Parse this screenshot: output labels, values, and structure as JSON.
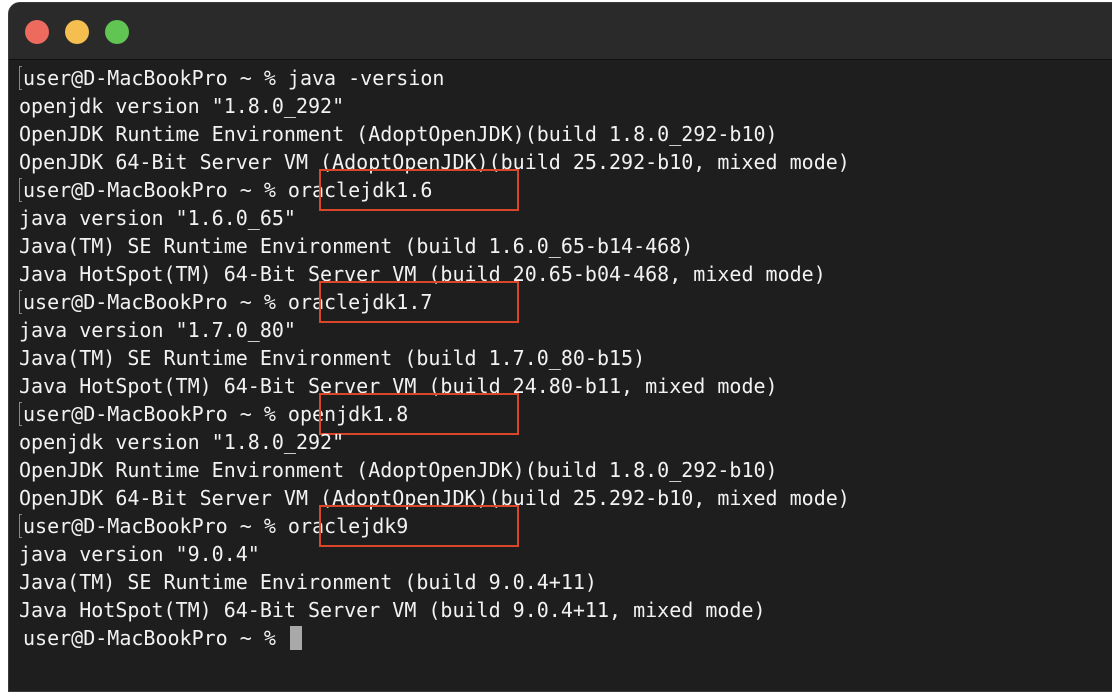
{
  "window": {
    "traffic_light_colors": {
      "close": "#ed6a5e",
      "minimize": "#f5bf4f",
      "zoom": "#61c554"
    },
    "highlight_color": "#d9472a"
  },
  "terminal": {
    "prompt": "user@D-MacBookPro ~ % ",
    "lines": [
      {
        "type": "prompt",
        "command": "java -version"
      },
      {
        "type": "output",
        "text": "openjdk version \"1.8.0_292\""
      },
      {
        "type": "output",
        "text": "OpenJDK Runtime Environment (AdoptOpenJDK)(build 1.8.0_292-b10)"
      },
      {
        "type": "output",
        "text": "OpenJDK 64-Bit Server VM (AdoptOpenJDK)(build 25.292-b10, mixed mode)"
      },
      {
        "type": "prompt",
        "command": "oraclejdk1.6",
        "highlighted": true
      },
      {
        "type": "output",
        "text": "java version \"1.6.0_65\""
      },
      {
        "type": "output",
        "text": "Java(TM) SE Runtime Environment (build 1.6.0_65-b14-468)"
      },
      {
        "type": "output",
        "text": "Java HotSpot(TM) 64-Bit Server VM (build 20.65-b04-468, mixed mode)"
      },
      {
        "type": "prompt",
        "command": "oraclejdk1.7",
        "highlighted": true
      },
      {
        "type": "output",
        "text": "java version \"1.7.0_80\""
      },
      {
        "type": "output",
        "text": "Java(TM) SE Runtime Environment (build 1.7.0_80-b15)"
      },
      {
        "type": "output",
        "text": "Java HotSpot(TM) 64-Bit Server VM (build 24.80-b11, mixed mode)"
      },
      {
        "type": "prompt",
        "command": "openjdk1.8",
        "highlighted": true
      },
      {
        "type": "output",
        "text": "openjdk version \"1.8.0_292\""
      },
      {
        "type": "output",
        "text": "OpenJDK Runtime Environment (AdoptOpenJDK)(build 1.8.0_292-b10)"
      },
      {
        "type": "output",
        "text": "OpenJDK 64-Bit Server VM (AdoptOpenJDK)(build 25.292-b10, mixed mode)"
      },
      {
        "type": "prompt",
        "command": "oraclejdk9",
        "highlighted": true
      },
      {
        "type": "output",
        "text": "java version \"9.0.4\""
      },
      {
        "type": "output",
        "text": "Java(TM) SE Runtime Environment (build 9.0.4+11)"
      },
      {
        "type": "output",
        "text": "Java HotSpot(TM) 64-Bit Server VM (build 9.0.4+11, mixed mode)"
      },
      {
        "type": "active_prompt",
        "command": ""
      }
    ]
  }
}
